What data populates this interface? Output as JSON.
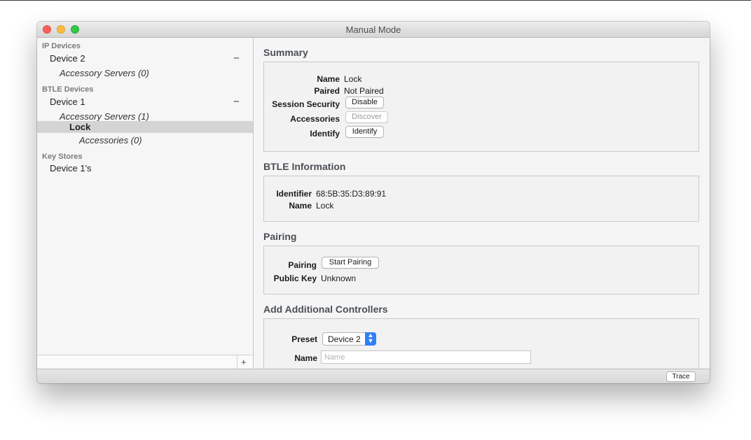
{
  "window": {
    "title": "Manual Mode"
  },
  "sidebar": {
    "ip_devices": {
      "header": "IP Devices",
      "device": "Device 2",
      "collapse": "−",
      "accessory_servers": "Accessory Servers (0)"
    },
    "btle_devices": {
      "header": "BTLE Devices",
      "device": "Device 1",
      "collapse": "−",
      "accessory_servers": "Accessory Servers (1)",
      "selected_item": "Lock",
      "accessories": "Accessories (0)"
    },
    "key_stores": {
      "header": "Key Stores",
      "item": "Device 1's"
    },
    "add_button": "+"
  },
  "summary": {
    "title": "Summary",
    "name_label": "Name",
    "name_value": "Lock",
    "paired_label": "Paired",
    "paired_value": "Not Paired",
    "session_label": "Session Security",
    "session_button": "Disable",
    "accessories_label": "Accessories",
    "accessories_button": "Discover",
    "identify_label": "Identify",
    "identify_button": "Identify"
  },
  "btle_info": {
    "title": "BTLE Information",
    "identifier_label": "Identifier",
    "identifier_value": "68:5B:35:D3:89:91",
    "name_label": "Name",
    "name_value": "Lock"
  },
  "pairing": {
    "title": "Pairing",
    "pairing_label": "Pairing",
    "pairing_button": "Start Pairing",
    "public_key_label": "Public Key",
    "public_key_value": "Unknown"
  },
  "controllers": {
    "title": "Add Additional Controllers",
    "preset_label": "Preset",
    "preset_value": "Device 2",
    "name_label": "Name",
    "name_placeholder": "Name"
  },
  "bottom": {
    "trace_button": "Trace"
  },
  "colors": {
    "accent": "#2f7ff6",
    "selection": "#d4d4d4"
  }
}
